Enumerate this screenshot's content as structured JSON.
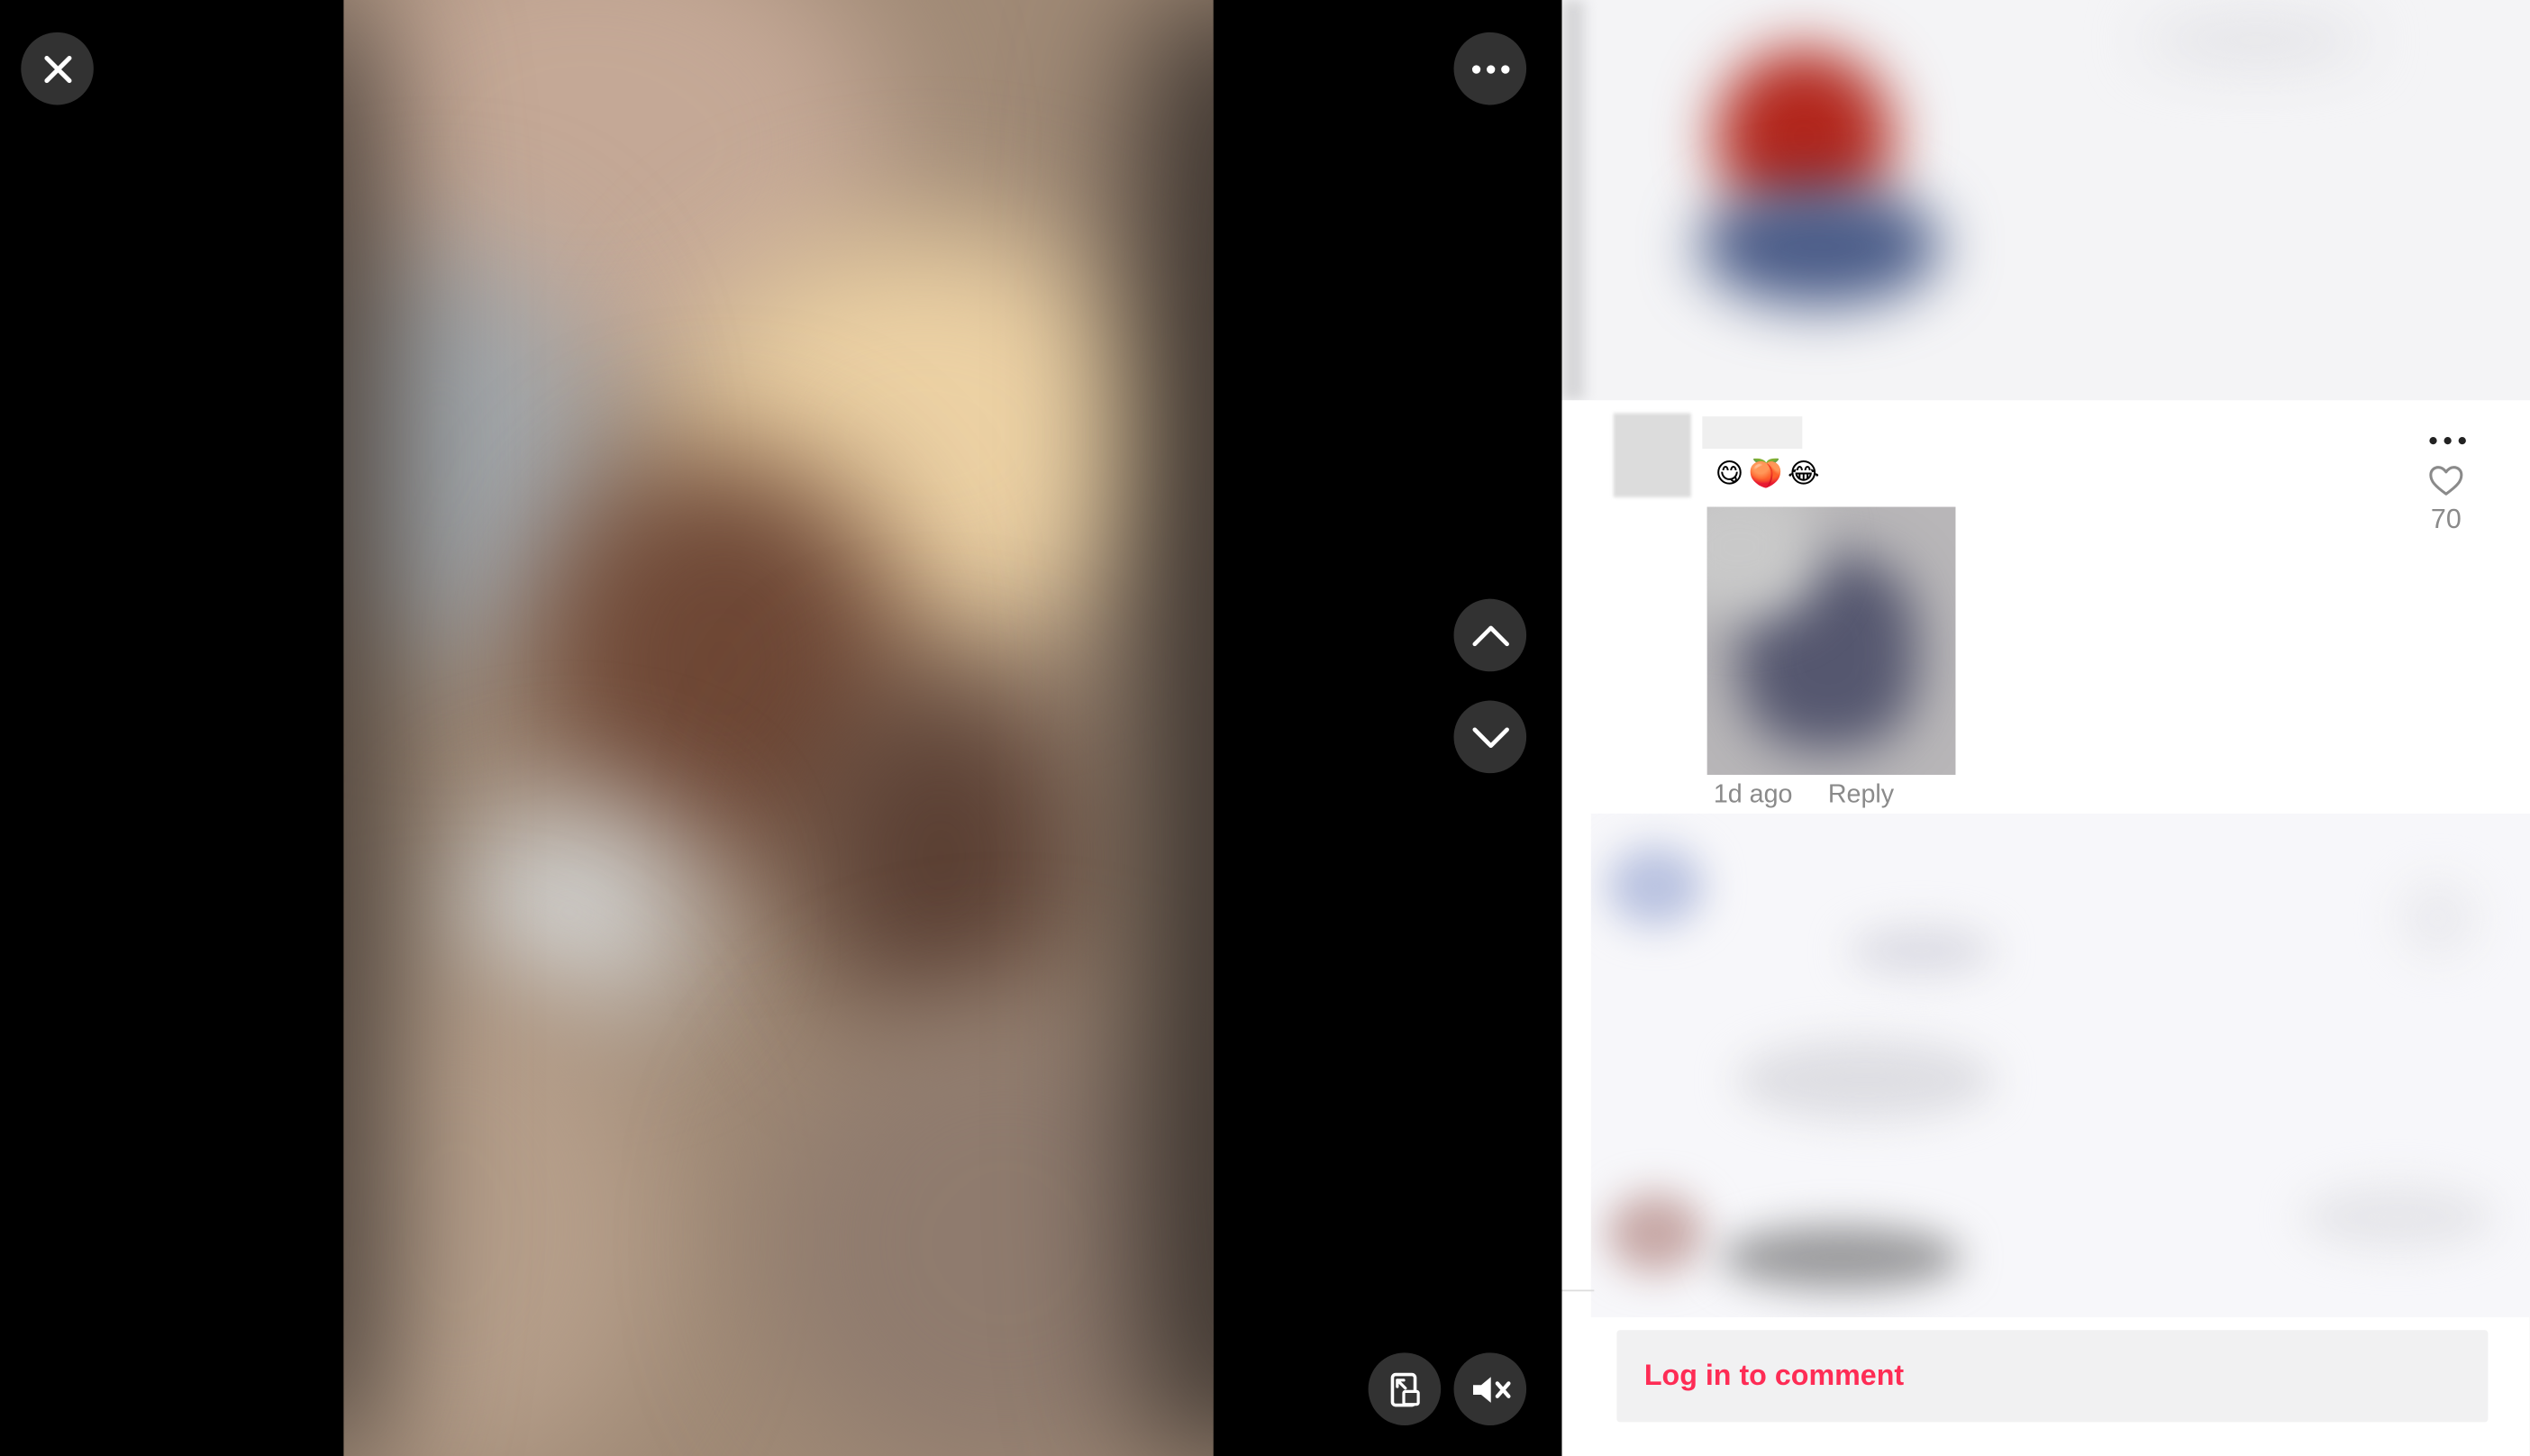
{
  "player": {
    "close_icon": "close-icon",
    "more_icon": "more-horizontal-icon",
    "prev_icon": "chevron-up-icon",
    "next_icon": "chevron-down-icon",
    "float_icon": "floating-player-icon",
    "mute_icon": "volume-muted-icon"
  },
  "comment": {
    "text": "😋🍑😂",
    "time": "1d ago",
    "reply_label": "Reply",
    "like_count": "70",
    "more_icon": "more-horizontal-icon",
    "like_icon": "heart-outline-icon"
  },
  "composer": {
    "login_label": "Log in to comment"
  },
  "colors": {
    "accent": "#fe2c55",
    "muted_text": "#8a8a8a",
    "control_bg": "#363636"
  }
}
